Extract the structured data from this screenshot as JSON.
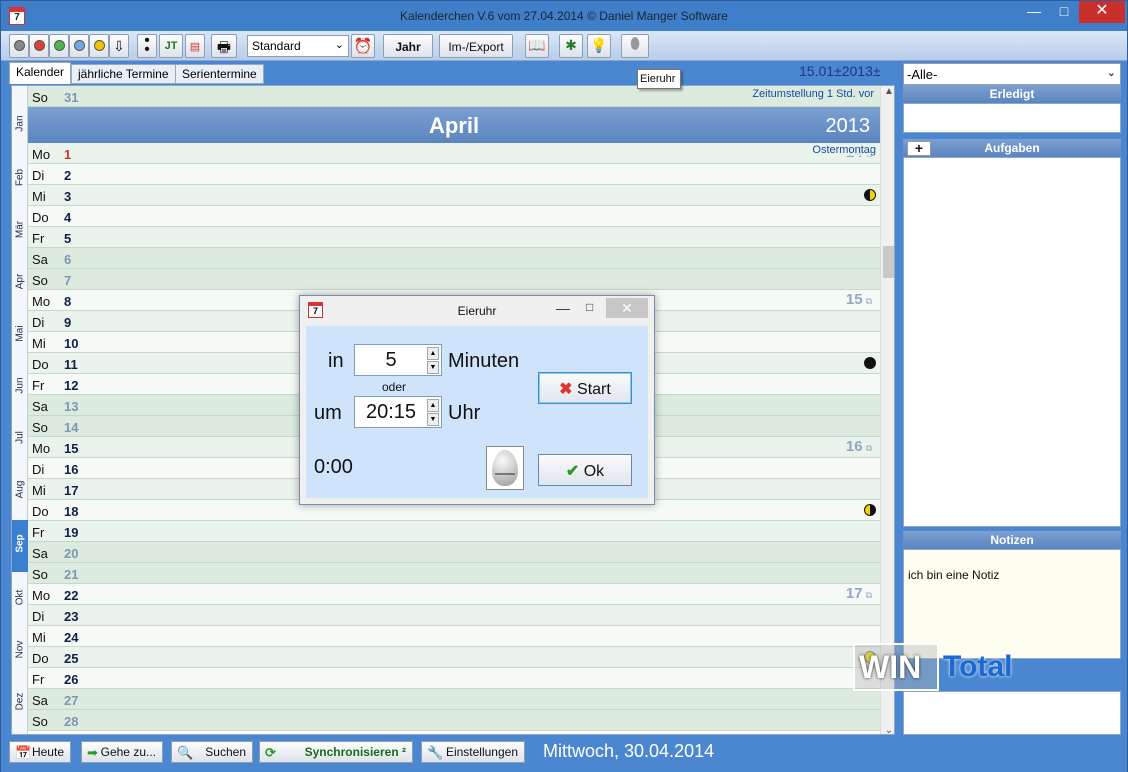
{
  "window": {
    "title": "Kalenderchen V.6 vom 27.04.2014 © Daniel Manger Software",
    "app_icon_text": "7",
    "minimize": "—",
    "maximize": "□",
    "close": "✕"
  },
  "toolbar": {
    "jt_label": "JT",
    "view_select": "Standard",
    "jahr_label": "Jahr",
    "import_export_label": "Im-/Export",
    "tooltip": "Eieruhr"
  },
  "tabs": [
    {
      "label": "Kalender"
    },
    {
      "label": "jährliche Termine"
    },
    {
      "label": "Serientermine"
    }
  ],
  "date_info": "15.01±2013±",
  "months": [
    "Jan",
    "Feb",
    "Mär",
    "Apr",
    "Mai",
    "Jun",
    "Jul",
    "Aug",
    "Sep",
    "Okt",
    "Nov",
    "Dez"
  ],
  "calendar": {
    "top_row": {
      "weekday": "So",
      "day": "31",
      "note": "Zeitumstellung 1 Std. vor"
    },
    "month_name": "April",
    "year": "2013",
    "days": [
      {
        "weekday": "Mo",
        "day": "1",
        "holiday": "Ostermontag",
        "week": "14"
      },
      {
        "weekday": "Di",
        "day": "2"
      },
      {
        "weekday": "Mi",
        "day": "3",
        "moon": "last"
      },
      {
        "weekday": "Do",
        "day": "4"
      },
      {
        "weekday": "Fr",
        "day": "5"
      },
      {
        "weekday": "Sa",
        "day": "6"
      },
      {
        "weekday": "So",
        "day": "7"
      },
      {
        "weekday": "Mo",
        "day": "8",
        "week": "15"
      },
      {
        "weekday": "Di",
        "day": "9"
      },
      {
        "weekday": "Mi",
        "day": "10"
      },
      {
        "weekday": "Do",
        "day": "11",
        "moon": "new"
      },
      {
        "weekday": "Fr",
        "day": "12"
      },
      {
        "weekday": "Sa",
        "day": "13"
      },
      {
        "weekday": "So",
        "day": "14"
      },
      {
        "weekday": "Mo",
        "day": "15",
        "week": "16"
      },
      {
        "weekday": "Di",
        "day": "16"
      },
      {
        "weekday": "Mi",
        "day": "17"
      },
      {
        "weekday": "Do",
        "day": "18",
        "moon": "first"
      },
      {
        "weekday": "Fr",
        "day": "19"
      },
      {
        "weekday": "Sa",
        "day": "20"
      },
      {
        "weekday": "So",
        "day": "21"
      },
      {
        "weekday": "Mo",
        "day": "22",
        "week": "17"
      },
      {
        "weekday": "Di",
        "day": "23"
      },
      {
        "weekday": "Mi",
        "day": "24"
      },
      {
        "weekday": "Do",
        "day": "25",
        "moon": "full"
      },
      {
        "weekday": "Fr",
        "day": "26"
      },
      {
        "weekday": "Sa",
        "day": "27"
      },
      {
        "weekday": "So",
        "day": "28"
      }
    ]
  },
  "right_panel": {
    "filter": "-Alle-",
    "erledigt": "Erledigt",
    "aufgaben": "Aufgaben",
    "add_label": "+",
    "notizen": "Notizen",
    "note_text": "ich bin eine Notiz"
  },
  "watermark": {
    "win": "WIN",
    "total": "Total"
  },
  "statusbar": {
    "heute": "Heute",
    "gehe_zu": "Gehe zu...",
    "suchen": "Suchen",
    "sync": "Synchronisieren ²",
    "einstellungen": "Einstellungen",
    "date": "Mittwoch, 30.04.2014"
  },
  "dialog": {
    "title": "Eieruhr",
    "in_label": "in",
    "minutes_value": "5",
    "minutes_label": "Minuten",
    "oder_label": "oder",
    "um_label": "um",
    "time_value": "20:15",
    "uhr_label": "Uhr",
    "start_label": "Start",
    "ok_label": "Ok",
    "countdown": "0:00"
  },
  "colors": {
    "accent": "#4a87d0",
    "header_band": "#5b85c0",
    "weekday_row": "#eaf4ec",
    "weekend_row": "#dcebde"
  }
}
